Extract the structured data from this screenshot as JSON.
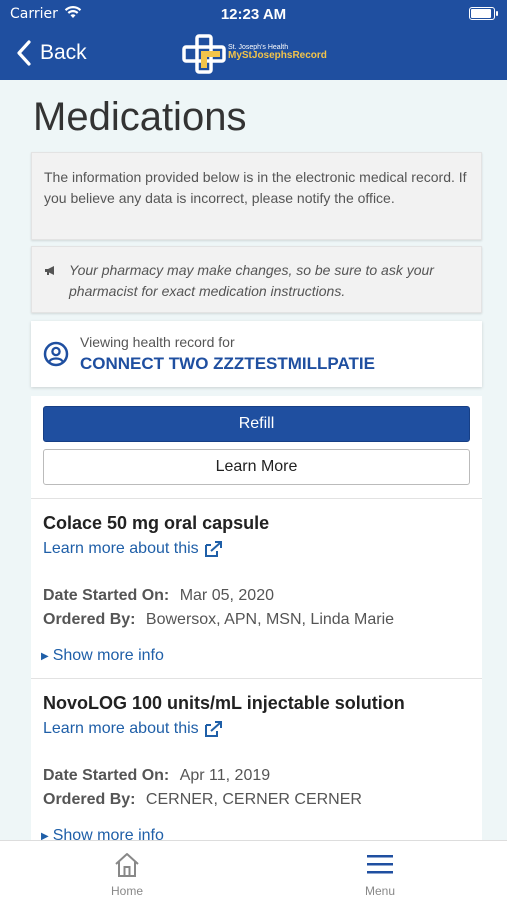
{
  "status_bar": {
    "carrier": "Carrier",
    "time": "12:23 AM"
  },
  "nav": {
    "back_label": "Back",
    "logo_line1": "St. Joseph's Health",
    "logo_line2": "MyStJosephsRecord"
  },
  "page": {
    "title": "Medications"
  },
  "notices": {
    "info": "The information provided below is in the electronic medical record. If you believe any data is incorrect, please notify the office.",
    "pharmacy": "Your pharmacy may make changes, so be sure to ask your pharmacist for exact medication instructions."
  },
  "viewing": {
    "label": "Viewing health record for",
    "name": "CONNECT TWO ZZZTESTMILLPATIE"
  },
  "actions": {
    "refill": "Refill",
    "learn_more": "Learn More"
  },
  "medications": [
    {
      "name": "Colace 50 mg oral capsule",
      "link": "Learn more about this",
      "date_label": "Date Started On:",
      "date": "Mar 05, 2020",
      "ordered_label": "Ordered By:",
      "ordered_by": "Bowersox, APN, MSN, Linda Marie",
      "show_more": "Show more info"
    },
    {
      "name": "NovoLOG 100 units/mL injectable solution",
      "link": "Learn more about this",
      "date_label": "Date Started On:",
      "date": "Apr 11, 2019",
      "ordered_label": "Ordered By:",
      "ordered_by": "CERNER, CERNER CERNER",
      "show_more": "Show more info"
    }
  ],
  "tabbar": {
    "home": "Home",
    "menu": "Menu"
  },
  "colors": {
    "brand_blue": "#1f4fa0",
    "link_blue": "#1f5fa8",
    "logo_gold": "#f3c44a",
    "background": "#eef6f7"
  },
  "icons": [
    "wifi-icon",
    "battery-icon",
    "back-chevron-icon",
    "logo-cross-icon",
    "megaphone-icon",
    "user-circle-icon",
    "external-link-icon",
    "caret-right-icon",
    "home-icon",
    "menu-icon"
  ]
}
